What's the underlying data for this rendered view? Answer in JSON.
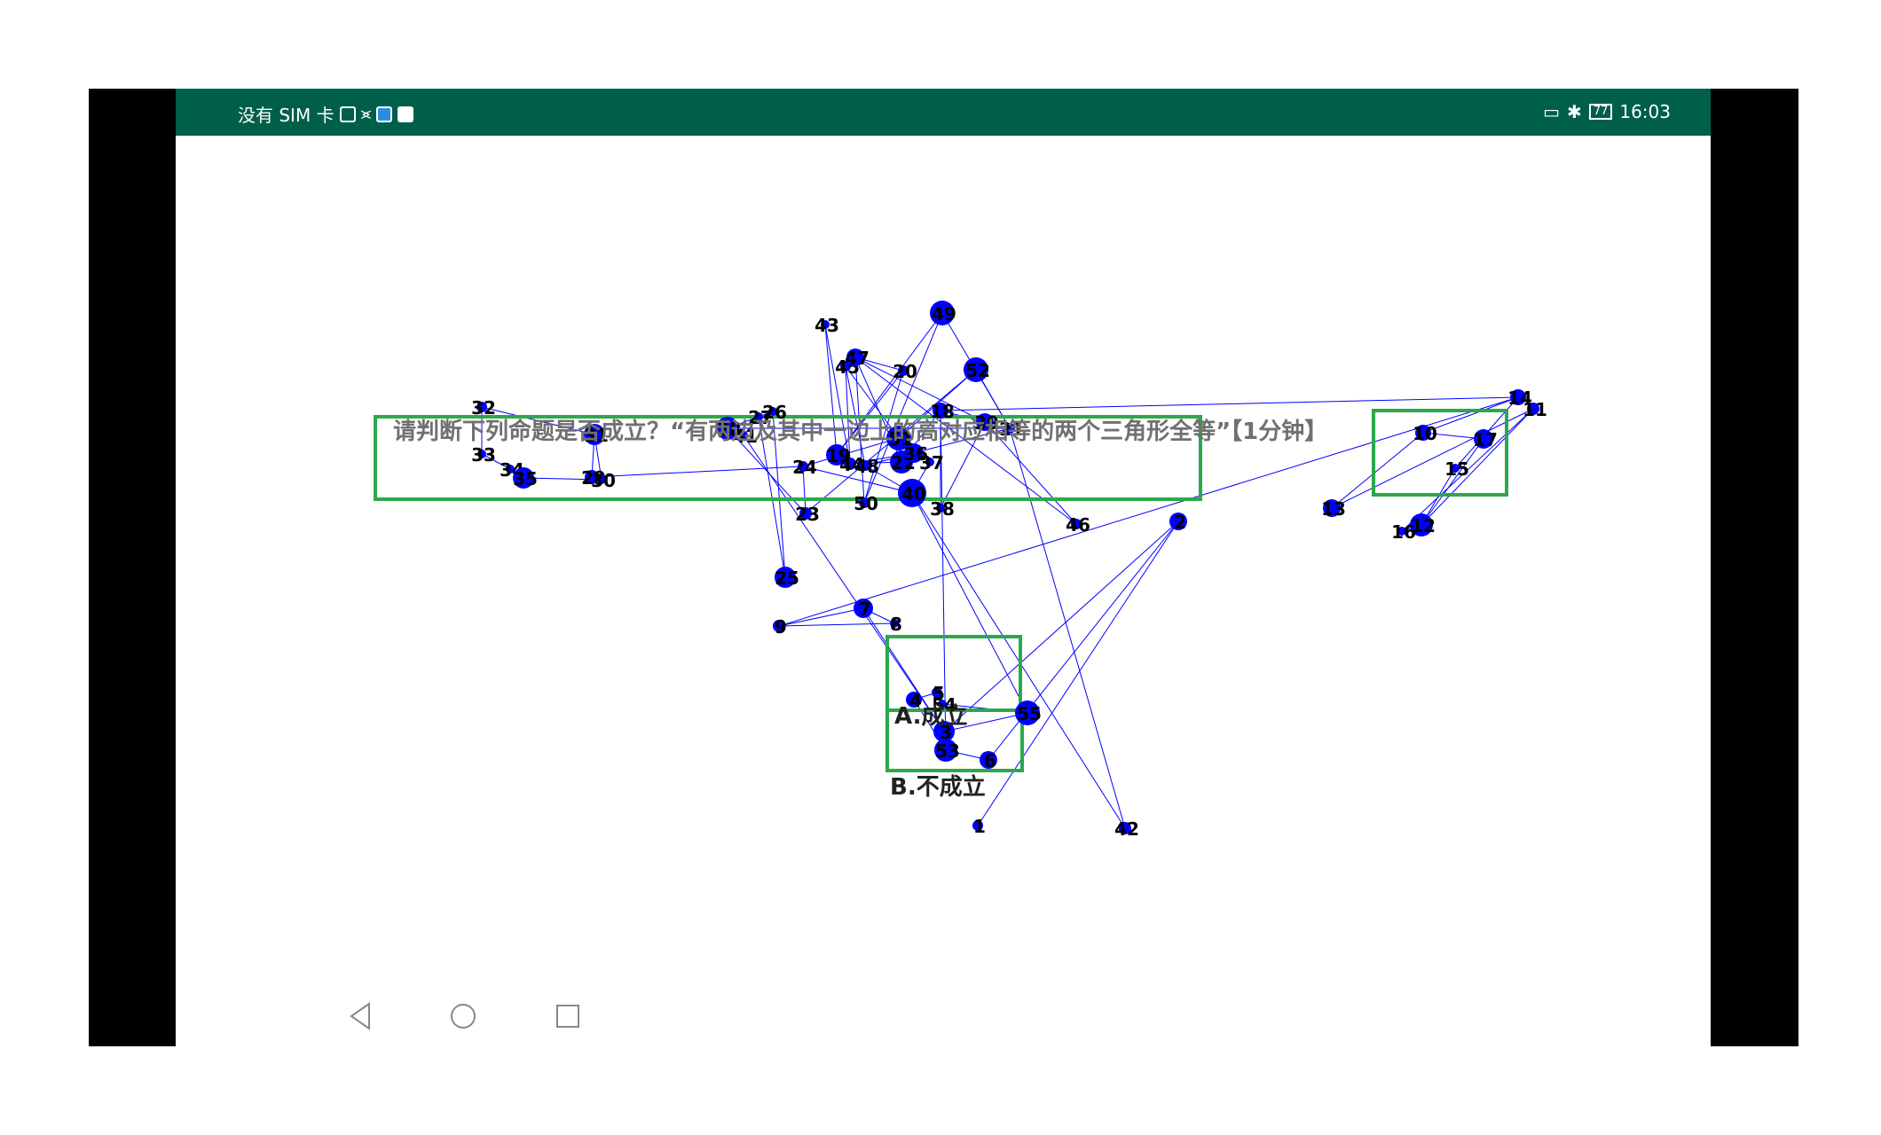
{
  "status_bar": {
    "left_text": "没有 SIM 卡",
    "time": "16:03",
    "battery": "77",
    "bg_color": "#005f49"
  },
  "question": {
    "text": "请判断下列命题是否成立？“有两边及其中一边上的高对应相等的两个三角形全等”【1分钟】"
  },
  "options": [
    {
      "label": "A.成立"
    },
    {
      "label": "B.不成立"
    }
  ],
  "nav": {
    "back_icon": "back-triangle-icon",
    "home_icon": "home-circle-icon",
    "recents_icon": "recents-square-icon"
  },
  "graph": {
    "node_color": "#0000ff",
    "edge_color": "#0000ff",
    "box_color": "#2ca84a",
    "nodes": [
      {
        "id": "1",
        "r": 6
      },
      {
        "id": "2",
        "r": 10
      },
      {
        "id": "3",
        "r": 12
      },
      {
        "id": "4",
        "r": 9
      },
      {
        "id": "5",
        "r": 6
      },
      {
        "id": "6",
        "r": 10
      },
      {
        "id": "7",
        "r": 11
      },
      {
        "id": "8",
        "r": 5
      },
      {
        "id": "9",
        "r": 7
      },
      {
        "id": "10",
        "r": 9
      },
      {
        "id": "11",
        "r": 7
      },
      {
        "id": "12",
        "r": 13
      },
      {
        "id": "13",
        "r": 10
      },
      {
        "id": "14",
        "r": 9
      },
      {
        "id": "15",
        "r": 5
      },
      {
        "id": "16",
        "r": 5
      },
      {
        "id": "17",
        "r": 11
      },
      {
        "id": "18",
        "r": 9
      },
      {
        "id": "19",
        "r": 12
      },
      {
        "id": "20",
        "r": 6
      },
      {
        "id": "21",
        "r": 6
      },
      {
        "id": "22",
        "r": 13
      },
      {
        "id": "23",
        "r": 7
      },
      {
        "id": "24",
        "r": 6
      },
      {
        "id": "25",
        "r": 12
      },
      {
        "id": "26",
        "r": 5
      },
      {
        "id": "27",
        "r": 5
      },
      {
        "id": "28",
        "r": 13
      },
      {
        "id": "29",
        "r": 8
      },
      {
        "id": "30",
        "r": 5
      },
      {
        "id": "31",
        "r": 12
      },
      {
        "id": "32",
        "r": 6
      },
      {
        "id": "33",
        "r": 5
      },
      {
        "id": "34",
        "r": 5
      },
      {
        "id": "35",
        "r": 12
      },
      {
        "id": "36",
        "r": 11
      },
      {
        "id": "37",
        "r": 5
      },
      {
        "id": "38",
        "r": 5
      },
      {
        "id": "39",
        "r": 10
      },
      {
        "id": "40",
        "r": 16
      },
      {
        "id": "41",
        "r": 5
      },
      {
        "id": "42",
        "r": 7
      },
      {
        "id": "43",
        "r": 5
      },
      {
        "id": "44",
        "r": 7
      },
      {
        "id": "45",
        "r": 6
      },
      {
        "id": "46",
        "r": 6
      },
      {
        "id": "47",
        "r": 10
      },
      {
        "id": "48",
        "r": 6
      },
      {
        "id": "49",
        "r": 14
      },
      {
        "id": "50",
        "r": 6
      },
      {
        "id": "51",
        "r": 14
      },
      {
        "id": "52",
        "r": 14
      },
      {
        "id": "53",
        "r": 13
      },
      {
        "id": "54",
        "r": 5
      },
      {
        "id": "55",
        "r": 14
      }
    ],
    "edges": [
      [
        "43",
        "44"
      ],
      [
        "43",
        "19"
      ],
      [
        "49",
        "19"
      ],
      [
        "49",
        "21"
      ],
      [
        "49",
        "50"
      ],
      [
        "47",
        "20"
      ],
      [
        "47",
        "22"
      ],
      [
        "47",
        "39"
      ],
      [
        "47",
        "46"
      ],
      [
        "45",
        "44"
      ],
      [
        "45",
        "51"
      ],
      [
        "20",
        "19"
      ],
      [
        "20",
        "50"
      ],
      [
        "52",
        "51"
      ],
      [
        "52",
        "21"
      ],
      [
        "52",
        "23"
      ],
      [
        "18",
        "14"
      ],
      [
        "18",
        "39"
      ],
      [
        "18",
        "22"
      ],
      [
        "18",
        "38"
      ],
      [
        "39",
        "46"
      ],
      [
        "39",
        "38"
      ],
      [
        "51",
        "36"
      ],
      [
        "51",
        "22"
      ],
      [
        "51",
        "24"
      ],
      [
        "22",
        "36"
      ],
      [
        "36",
        "37"
      ],
      [
        "37",
        "40"
      ],
      [
        "40",
        "48"
      ],
      [
        "40",
        "42"
      ],
      [
        "40",
        "24"
      ],
      [
        "24",
        "23"
      ],
      [
        "24",
        "29"
      ],
      [
        "23",
        "28"
      ],
      [
        "28",
        "26"
      ],
      [
        "28",
        "21"
      ],
      [
        "26",
        "25"
      ],
      [
        "27",
        "25"
      ],
      [
        "27",
        "41"
      ],
      [
        "41",
        "3"
      ],
      [
        "31",
        "32"
      ],
      [
        "31",
        "29"
      ],
      [
        "31",
        "30"
      ],
      [
        "32",
        "33"
      ],
      [
        "33",
        "34"
      ],
      [
        "34",
        "35"
      ],
      [
        "35",
        "30"
      ],
      [
        "9",
        "14"
      ],
      [
        "9",
        "7"
      ],
      [
        "9",
        "8"
      ],
      [
        "7",
        "8"
      ],
      [
        "7",
        "3"
      ],
      [
        "3",
        "55"
      ],
      [
        "55",
        "54"
      ],
      [
        "54",
        "5"
      ],
      [
        "5",
        "4"
      ],
      [
        "4",
        "53"
      ],
      [
        "53",
        "6"
      ],
      [
        "6",
        "2"
      ],
      [
        "2",
        "1"
      ],
      [
        "2",
        "3"
      ],
      [
        "55",
        "40"
      ],
      [
        "53",
        "18"
      ],
      [
        "10",
        "17"
      ],
      [
        "10",
        "14"
      ],
      [
        "10",
        "13"
      ],
      [
        "11",
        "12"
      ],
      [
        "11",
        "13"
      ],
      [
        "11",
        "16"
      ],
      [
        "14",
        "15"
      ],
      [
        "15",
        "12"
      ],
      [
        "17",
        "12"
      ],
      [
        "16",
        "12"
      ],
      [
        "42",
        "21"
      ],
      [
        "19",
        "48"
      ],
      [
        "44",
        "36"
      ],
      [
        "21",
        "48"
      ],
      [
        "22",
        "44"
      ],
      [
        "45",
        "48"
      ],
      [
        "50",
        "47"
      ]
    ]
  }
}
